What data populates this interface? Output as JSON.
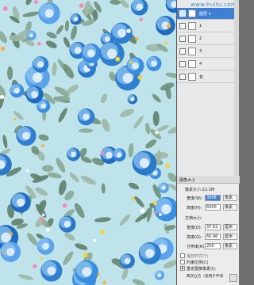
{
  "watermark": "www.huitu.com",
  "layers": [
    {
      "label": "图层 1",
      "selected": true
    },
    {
      "label": "1",
      "selected": false
    },
    {
      "label": "2",
      "selected": false
    },
    {
      "label": "3",
      "selected": false
    },
    {
      "label": "4",
      "selected": false
    },
    {
      "label": "背",
      "selected": false
    }
  ],
  "dialog": {
    "title": "图像大小",
    "size_label": "像素大小:22.2M",
    "pixel_width_label": "宽度(W):",
    "pixel_width_value": "3888",
    "pixel_width_unit": "像素",
    "pixel_height_label": "高度(H):",
    "pixel_height_value": "6000",
    "pixel_height_unit": "像素",
    "doc_size_label": "文档大小:",
    "doc_width_label": "宽度(D):",
    "doc_width_value": "37.62",
    "doc_width_unit": "厘米",
    "doc_height_label": "高度(G):",
    "doc_height_value": "60.96",
    "doc_height_unit": "厘米",
    "resolution_label": "分辨率(R):",
    "resolution_value": "256",
    "resolution_unit": "像素",
    "scale_styles_label": "缩放样式(Y)",
    "constrain_label": "约束比例(C)",
    "resample_label": "重定图像像素(I):",
    "resample_method": "两次立方（适用于平滑"
  },
  "colors": {
    "canvas_bg": "#bfe3ea",
    "selection": "#3e7fd6",
    "flower_blue": "#2f7fd0",
    "leaf": "#7a9b86"
  }
}
